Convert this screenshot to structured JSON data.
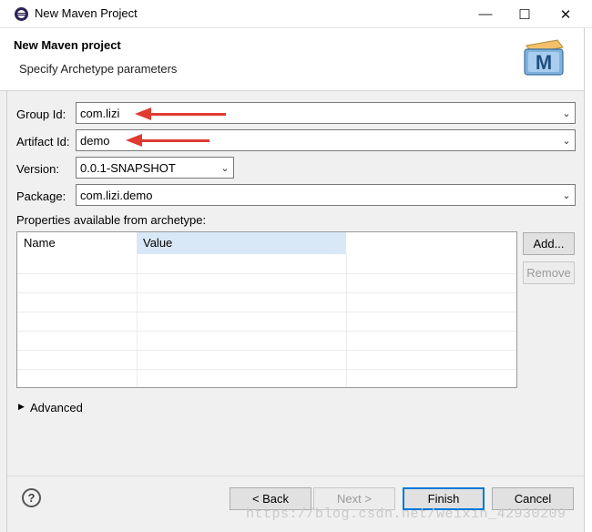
{
  "window": {
    "title": "New Maven Project",
    "controls": {
      "minimize": "—",
      "maximize": "☐",
      "close": "✕"
    }
  },
  "header": {
    "title": "New Maven project",
    "subtitle": "Specify Archetype parameters",
    "logo_letter": "M"
  },
  "form": {
    "group_id": {
      "label": "Group Id:",
      "value": "com.lizi"
    },
    "artifact_id": {
      "label": "Artifact Id:",
      "value": "demo"
    },
    "version": {
      "label": "Version:",
      "value": "0.0.1-SNAPSHOT"
    },
    "package": {
      "label": "Package:",
      "value": "com.lizi.demo"
    }
  },
  "properties": {
    "label": "Properties available from archetype:",
    "columns": [
      "Name",
      "Value"
    ],
    "rows": [],
    "add_label": "Add...",
    "remove_label": "Remove"
  },
  "advanced_label": "Advanced",
  "buttons": {
    "back": "< Back",
    "next": "Next >",
    "finish": "Finish",
    "cancel": "Cancel"
  },
  "watermark": "https://blog.csdn.net/weixin_42930209",
  "colors": {
    "annotation_arrow": "#e03a31",
    "default_button_border": "#0078d7",
    "selected_header": "#d9e8f6"
  }
}
